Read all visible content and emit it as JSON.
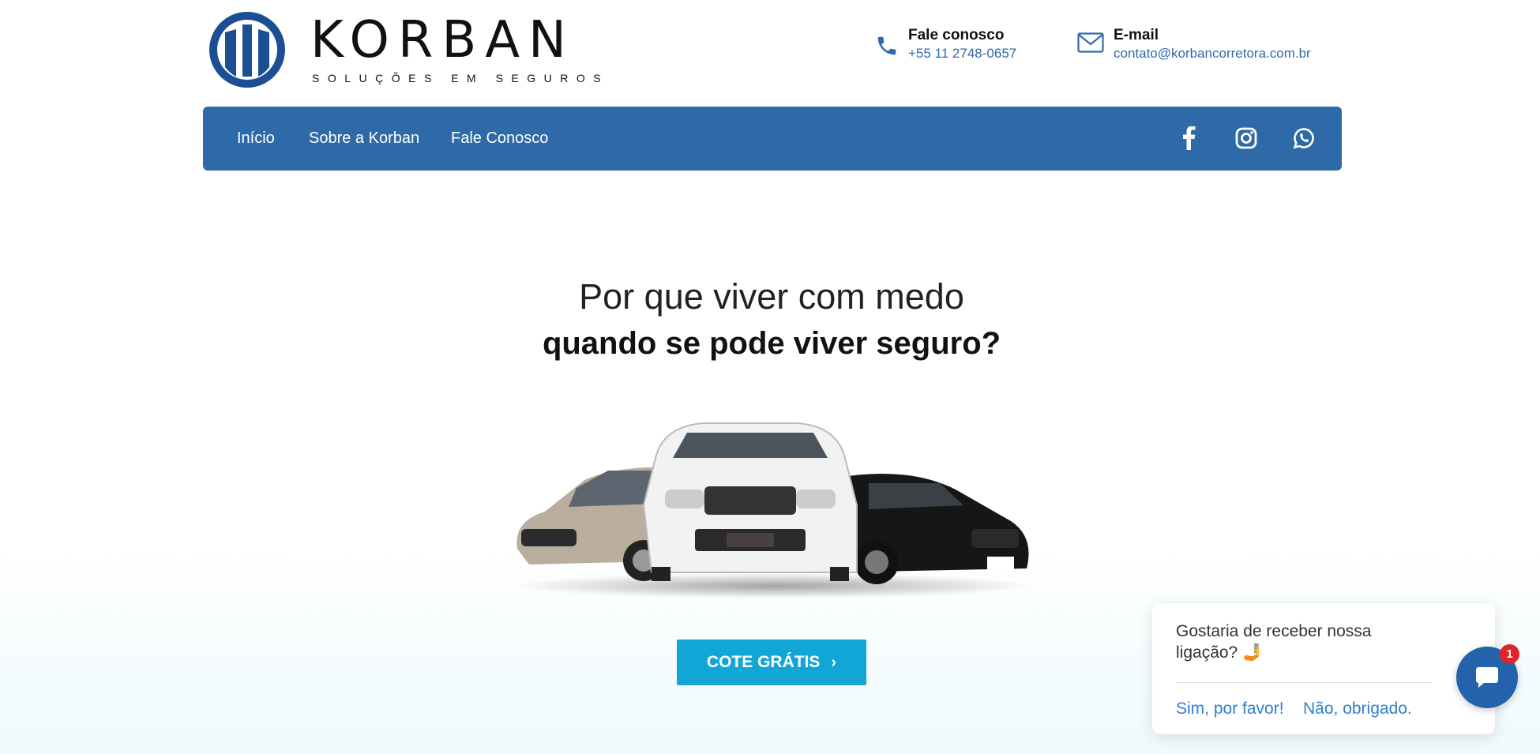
{
  "header": {
    "brand_name": "KORBAN",
    "brand_tagline": "SOLUÇÕES EM SEGUROS",
    "phone": {
      "title": "Fale conosco",
      "value": "+55 11 2748-0657",
      "icon": "phone-icon"
    },
    "email": {
      "title": "E-mail",
      "value": "contato@korbancorretora.com.br",
      "icon": "mail-icon"
    }
  },
  "nav": {
    "items": [
      {
        "label": "Início"
      },
      {
        "label": "Sobre a Korban"
      },
      {
        "label": "Fale Conosco"
      }
    ],
    "social": [
      "facebook-icon",
      "instagram-icon",
      "whatsapp-icon"
    ]
  },
  "hero": {
    "line1": "Por que viver com medo",
    "line2": "quando se pode viver seguro?",
    "cta_label": "COTE GRÁTIS",
    "cta_icon": "chevron-right-icon"
  },
  "chat": {
    "message": "Gostaria de receber nossa ligação? 🤳",
    "yes_label": "Sim, por favor!",
    "no_label": "Não, obrigado.",
    "badge_count": "1"
  },
  "colors": {
    "nav_bg": "#2f6aa8",
    "cta_bg": "#12a6d6",
    "chat_button": "#2463ab",
    "badge": "#e0252a"
  }
}
